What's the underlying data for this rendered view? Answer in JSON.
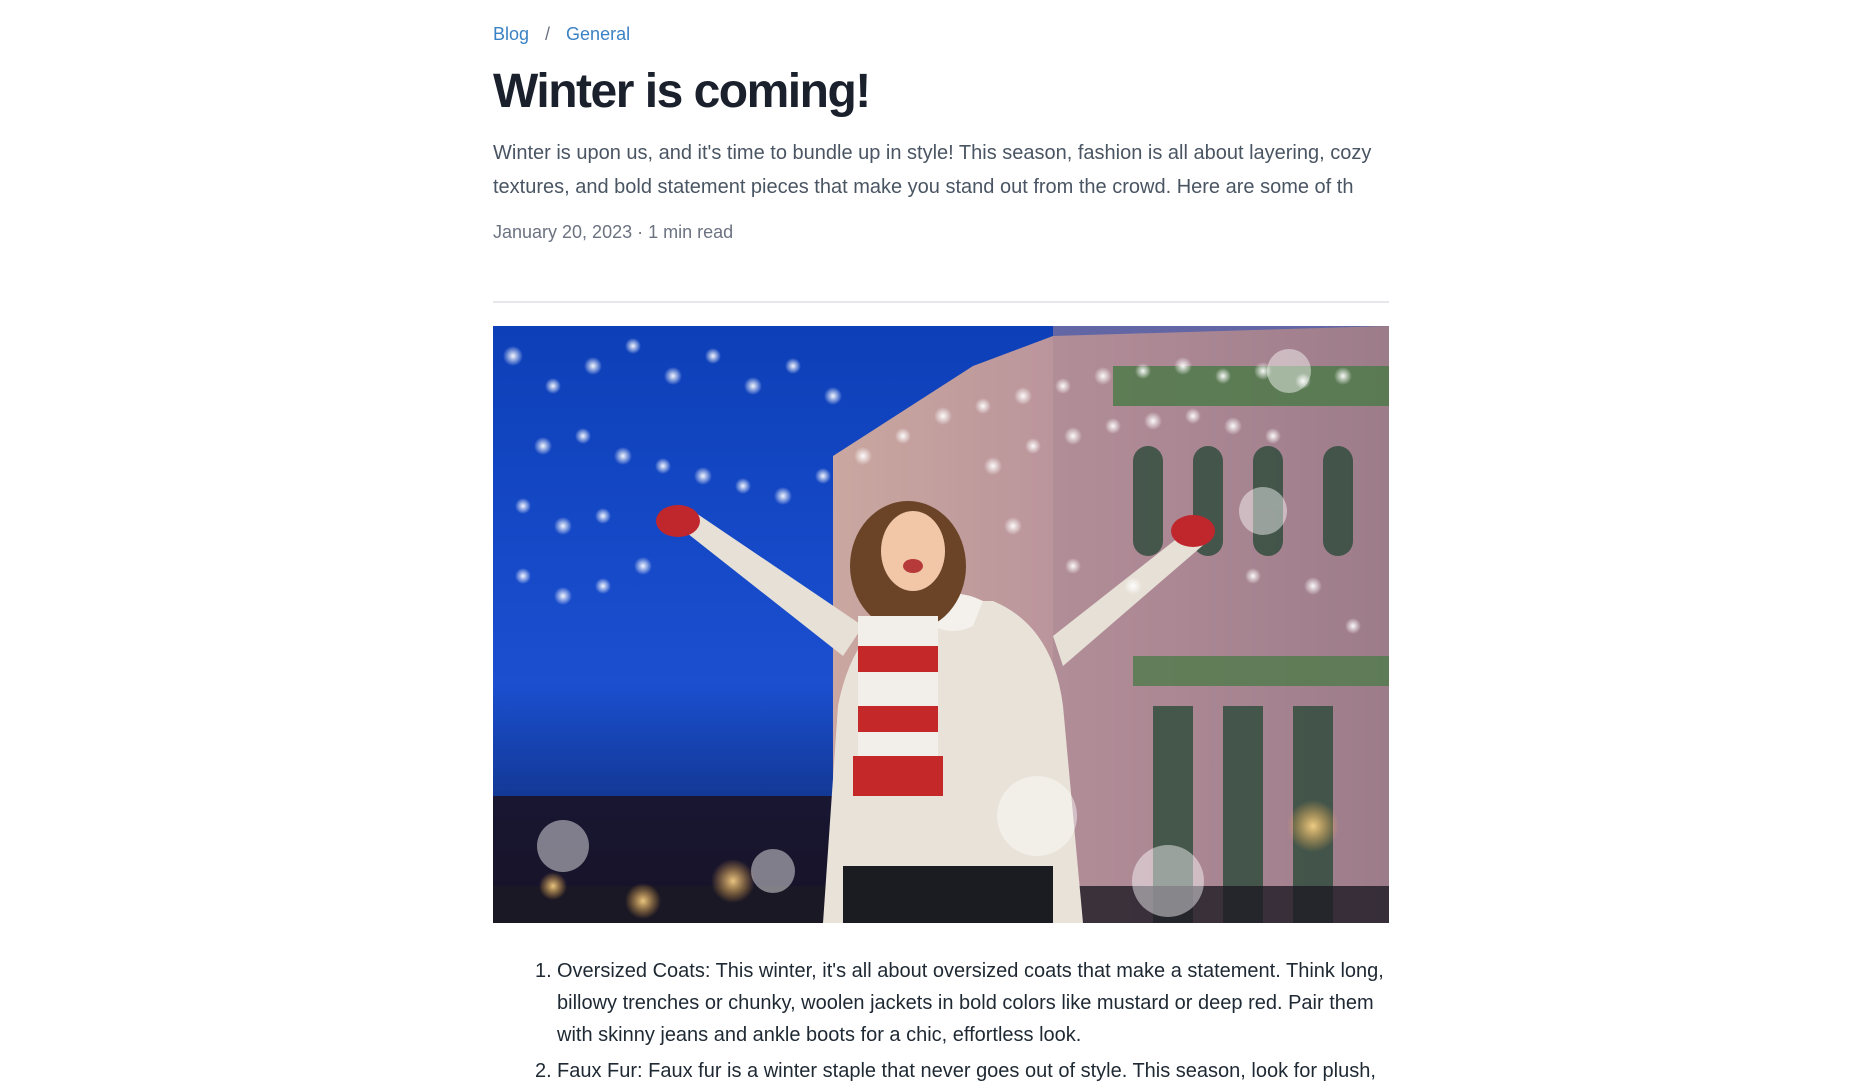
{
  "breadcrumb": {
    "items": [
      "Blog",
      "General"
    ],
    "separator": "/"
  },
  "post": {
    "title": "Winter is coming!",
    "excerpt": "Winter is upon us, and it's time to bundle up in style! This season, fashion is all about layering, cozy textures, and bold statement pieces that make you stand out from the crowd. Here are some of th",
    "date": "January 20, 2023",
    "read_time": "1 min read",
    "meta_separator": "·"
  },
  "hero_image": {
    "alt": "Woman in white coat and red scarf raising arms under festive lights in falling snow",
    "icon": "photo-image"
  },
  "list": [
    {
      "number": "1.",
      "text": "Oversized Coats: This winter, it's all about oversized coats that make a statement. Think long, billowy trenches or chunky, woolen jackets in bold colors like mustard or deep red. Pair them with skinny jeans and ankle boots for a chic, effortless look."
    },
    {
      "number": "2.",
      "text": "Faux Fur: Faux fur is a winter staple that never goes out of style. This season, look for plush,"
    }
  ],
  "colors": {
    "link": "#3b82c4",
    "title": "#1a202c",
    "muted": "#6b7280",
    "divider": "#e5e7eb"
  }
}
